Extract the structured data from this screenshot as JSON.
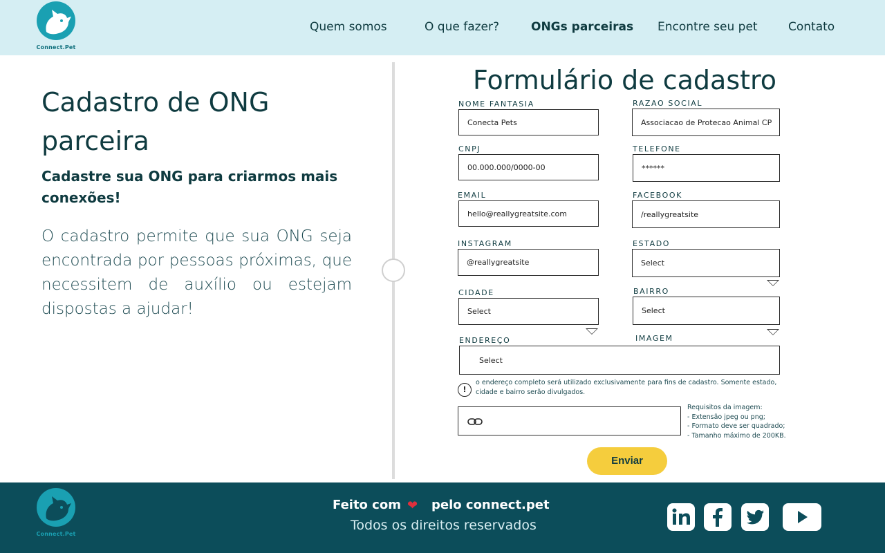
{
  "header": {
    "logo_text": "Connect.Pet",
    "nav": [
      "Quem somos",
      "O que fazer?",
      "ONGs parceiras",
      "Encontre seu pet",
      "Contato"
    ]
  },
  "left": {
    "title": "Cadastro de ONG parceira",
    "subtitle": "Cadastre sua ONG para criarmos mais conexões!",
    "body": "O cadastro permite que sua ONG seja encontrada por pessoas próximas, que necessitem de auxílio ou estejam dispostas a ajudar!"
  },
  "form": {
    "title": "Formulário de cadastro",
    "nome_fantasia": {
      "label": "NOME FANTASIA",
      "value": "Conecta Pets"
    },
    "razao_social": {
      "label": "RAZAO SOCIAL",
      "value": "Associacao de Protecao Animal CP"
    },
    "cnpj": {
      "label": "CNPJ",
      "value": "00.000.000/0000-00"
    },
    "telefone": {
      "label": "TELEFONE",
      "value": "******"
    },
    "email": {
      "label": "EMAIL",
      "value": "hello@reallygreatsite.com"
    },
    "facebook": {
      "label": "FACEBOOK",
      "value": "/reallygreatsite"
    },
    "instagram": {
      "label": "INSTAGRAM",
      "value": "@reallygreatsite"
    },
    "estado": {
      "label": "ESTADO",
      "value": "Select"
    },
    "cidade": {
      "label": "CIDADE",
      "value": "Select"
    },
    "bairro": {
      "label": "BAIRRO",
      "value": "Select"
    },
    "endereco": {
      "label": "ENDEREÇO",
      "value": "Select"
    },
    "imagem": {
      "label": "IMAGEM"
    },
    "info_icon": "!",
    "info_text": "o endereço completo será utilizado exclusivamente para fins de cadastro. Somente estado, cidade e bairro serão divulgados.",
    "requirements": [
      "Requisitos da imagem:",
      "- Extensão jpeg ou png;",
      "- Formato deve ser quadrado;",
      "- Tamanho máximo de 200KB."
    ],
    "submit_label": "Enviar"
  },
  "footer": {
    "logo_text": "Connect.Pet",
    "made_with": "Feito com",
    "made_by": "pelo connect.pet",
    "rights": "Todos os direitos reservados",
    "social": [
      "linkedin-icon",
      "facebook-icon",
      "twitter-icon",
      "youtube-icon"
    ]
  },
  "colors": {
    "header_bg": "#d5eef3",
    "footer_bg": "#0c4d5a",
    "accent": "#f5cd3d",
    "brand": "#1aa0b2"
  }
}
